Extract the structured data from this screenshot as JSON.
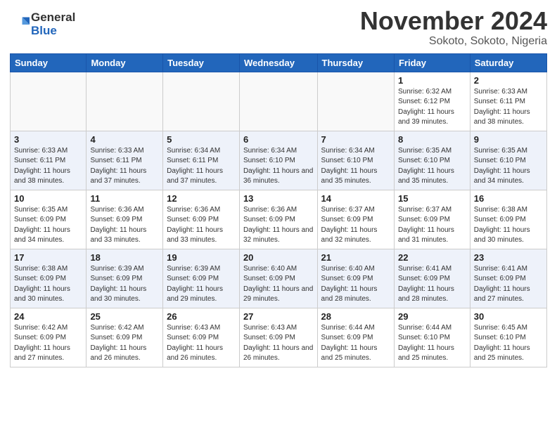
{
  "header": {
    "logo_general": "General",
    "logo_blue": "Blue",
    "month": "November 2024",
    "location": "Sokoto, Sokoto, Nigeria"
  },
  "days_of_week": [
    "Sunday",
    "Monday",
    "Tuesday",
    "Wednesday",
    "Thursday",
    "Friday",
    "Saturday"
  ],
  "weeks": [
    [
      {
        "day": "",
        "info": ""
      },
      {
        "day": "",
        "info": ""
      },
      {
        "day": "",
        "info": ""
      },
      {
        "day": "",
        "info": ""
      },
      {
        "day": "",
        "info": ""
      },
      {
        "day": "1",
        "info": "Sunrise: 6:32 AM\nSunset: 6:12 PM\nDaylight: 11 hours and 39 minutes."
      },
      {
        "day": "2",
        "info": "Sunrise: 6:33 AM\nSunset: 6:11 PM\nDaylight: 11 hours and 38 minutes."
      }
    ],
    [
      {
        "day": "3",
        "info": "Sunrise: 6:33 AM\nSunset: 6:11 PM\nDaylight: 11 hours and 38 minutes."
      },
      {
        "day": "4",
        "info": "Sunrise: 6:33 AM\nSunset: 6:11 PM\nDaylight: 11 hours and 37 minutes."
      },
      {
        "day": "5",
        "info": "Sunrise: 6:34 AM\nSunset: 6:11 PM\nDaylight: 11 hours and 37 minutes."
      },
      {
        "day": "6",
        "info": "Sunrise: 6:34 AM\nSunset: 6:10 PM\nDaylight: 11 hours and 36 minutes."
      },
      {
        "day": "7",
        "info": "Sunrise: 6:34 AM\nSunset: 6:10 PM\nDaylight: 11 hours and 35 minutes."
      },
      {
        "day": "8",
        "info": "Sunrise: 6:35 AM\nSunset: 6:10 PM\nDaylight: 11 hours and 35 minutes."
      },
      {
        "day": "9",
        "info": "Sunrise: 6:35 AM\nSunset: 6:10 PM\nDaylight: 11 hours and 34 minutes."
      }
    ],
    [
      {
        "day": "10",
        "info": "Sunrise: 6:35 AM\nSunset: 6:09 PM\nDaylight: 11 hours and 34 minutes."
      },
      {
        "day": "11",
        "info": "Sunrise: 6:36 AM\nSunset: 6:09 PM\nDaylight: 11 hours and 33 minutes."
      },
      {
        "day": "12",
        "info": "Sunrise: 6:36 AM\nSunset: 6:09 PM\nDaylight: 11 hours and 33 minutes."
      },
      {
        "day": "13",
        "info": "Sunrise: 6:36 AM\nSunset: 6:09 PM\nDaylight: 11 hours and 32 minutes."
      },
      {
        "day": "14",
        "info": "Sunrise: 6:37 AM\nSunset: 6:09 PM\nDaylight: 11 hours and 32 minutes."
      },
      {
        "day": "15",
        "info": "Sunrise: 6:37 AM\nSunset: 6:09 PM\nDaylight: 11 hours and 31 minutes."
      },
      {
        "day": "16",
        "info": "Sunrise: 6:38 AM\nSunset: 6:09 PM\nDaylight: 11 hours and 30 minutes."
      }
    ],
    [
      {
        "day": "17",
        "info": "Sunrise: 6:38 AM\nSunset: 6:09 PM\nDaylight: 11 hours and 30 minutes."
      },
      {
        "day": "18",
        "info": "Sunrise: 6:39 AM\nSunset: 6:09 PM\nDaylight: 11 hours and 30 minutes."
      },
      {
        "day": "19",
        "info": "Sunrise: 6:39 AM\nSunset: 6:09 PM\nDaylight: 11 hours and 29 minutes."
      },
      {
        "day": "20",
        "info": "Sunrise: 6:40 AM\nSunset: 6:09 PM\nDaylight: 11 hours and 29 minutes."
      },
      {
        "day": "21",
        "info": "Sunrise: 6:40 AM\nSunset: 6:09 PM\nDaylight: 11 hours and 28 minutes."
      },
      {
        "day": "22",
        "info": "Sunrise: 6:41 AM\nSunset: 6:09 PM\nDaylight: 11 hours and 28 minutes."
      },
      {
        "day": "23",
        "info": "Sunrise: 6:41 AM\nSunset: 6:09 PM\nDaylight: 11 hours and 27 minutes."
      }
    ],
    [
      {
        "day": "24",
        "info": "Sunrise: 6:42 AM\nSunset: 6:09 PM\nDaylight: 11 hours and 27 minutes."
      },
      {
        "day": "25",
        "info": "Sunrise: 6:42 AM\nSunset: 6:09 PM\nDaylight: 11 hours and 26 minutes."
      },
      {
        "day": "26",
        "info": "Sunrise: 6:43 AM\nSunset: 6:09 PM\nDaylight: 11 hours and 26 minutes."
      },
      {
        "day": "27",
        "info": "Sunrise: 6:43 AM\nSunset: 6:09 PM\nDaylight: 11 hours and 26 minutes."
      },
      {
        "day": "28",
        "info": "Sunrise: 6:44 AM\nSunset: 6:09 PM\nDaylight: 11 hours and 25 minutes."
      },
      {
        "day": "29",
        "info": "Sunrise: 6:44 AM\nSunset: 6:10 PM\nDaylight: 11 hours and 25 minutes."
      },
      {
        "day": "30",
        "info": "Sunrise: 6:45 AM\nSunset: 6:10 PM\nDaylight: 11 hours and 25 minutes."
      }
    ]
  ]
}
